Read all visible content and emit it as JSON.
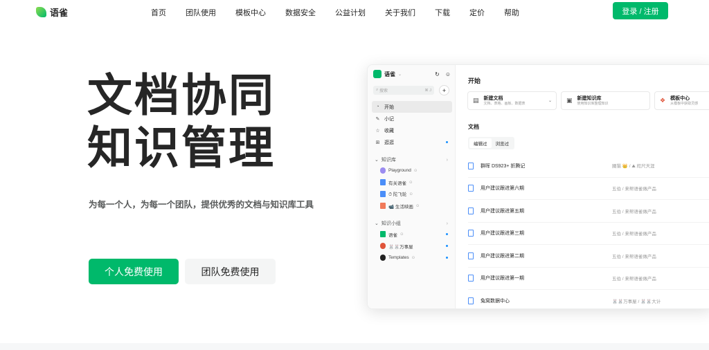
{
  "nav": {
    "logo_text": "语雀",
    "links": [
      "首页",
      "团队使用",
      "模板中心",
      "数据安全",
      "公益计划",
      "关于我们",
      "下载",
      "定价",
      "帮助"
    ],
    "login_label": "登录 / 注册"
  },
  "hero": {
    "title_line1": "文档协同",
    "title_line2": "知识管理",
    "subtitle": "为每一个人，为每一个团队，提供优秀的文档与知识库工具",
    "primary_button": "个人免费使用",
    "secondary_button": "团队免费使用"
  },
  "app": {
    "name": "语雀",
    "search_placeholder": "搜索",
    "search_shortcut": "⌘ J",
    "nav_items": [
      {
        "label": "开始",
        "icon": "clock-icon"
      },
      {
        "label": "小记",
        "icon": "pen-icon"
      },
      {
        "label": "收藏",
        "icon": "star-icon"
      },
      {
        "label": "逛逛",
        "icon": "grid-icon"
      }
    ],
    "kb_group": "知识库",
    "kb_items": [
      "Playground",
      "有关语雀",
      "⏱ 陀飞轮",
      "📹 生活映画"
    ],
    "team_group": "知识小组",
    "team_items": [
      "语雀",
      "🐰🐰万事屋",
      "Templates"
    ],
    "main_title": "开始",
    "cards": [
      {
        "title": "新建文档",
        "desc": "文档、表格、画板、数据表"
      },
      {
        "title": "新建知识库",
        "desc": "使用知识库整理知识"
      },
      {
        "title": "模板中心",
        "desc": "从模板中获取灵感"
      }
    ],
    "docs_title": "文档",
    "tabs": [
      "编辑过",
      "浏览过"
    ],
    "docs": [
      {
        "name": "群晖 DS923+ 折腾记",
        "source": "圈猫 👑 / ⛰ 咫尺天涯"
      },
      {
        "name": "用户建议跟进第六期",
        "source": "五伯 / 来帮语雀做产品"
      },
      {
        "name": "用户建议跟进第五期",
        "source": "五伯 / 来帮语雀做产品"
      },
      {
        "name": "用户建议跟进第三期",
        "source": "五伯 / 来帮语雀做产品"
      },
      {
        "name": "用户建议跟进第二期",
        "source": "五伯 / 来帮语雀做产品"
      },
      {
        "name": "用户建议跟进第一期",
        "source": "五伯 / 来帮语雀做产品"
      },
      {
        "name": "兔窝数据中心",
        "source": "🐰🐰万事屋 / 🐰🐰大计"
      }
    ]
  }
}
